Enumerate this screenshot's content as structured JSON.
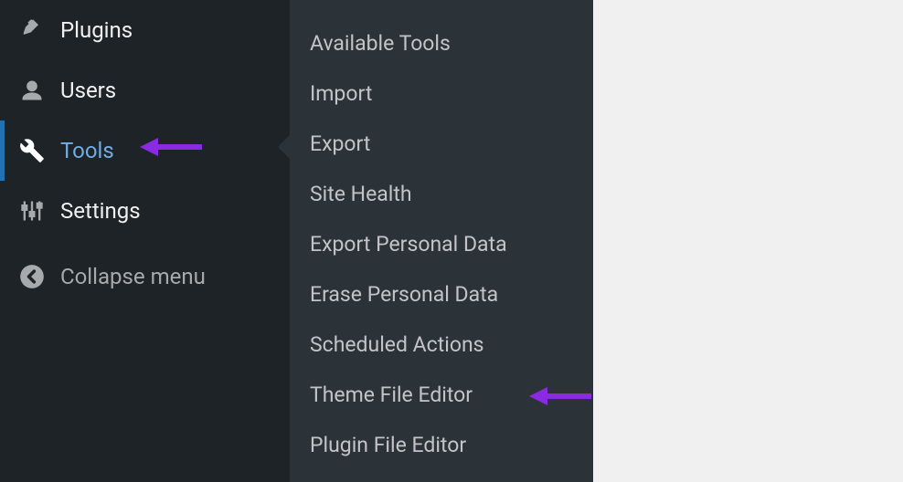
{
  "sidebar": {
    "items": [
      {
        "label": "Plugins",
        "icon": "plugin-icon"
      },
      {
        "label": "Users",
        "icon": "users-icon"
      },
      {
        "label": "Tools",
        "icon": "tools-icon",
        "active": true
      },
      {
        "label": "Settings",
        "icon": "settings-icon"
      }
    ],
    "collapse_label": "Collapse menu"
  },
  "submenu": {
    "items": [
      "Available Tools",
      "Import",
      "Export",
      "Site Health",
      "Export Personal Data",
      "Erase Personal Data",
      "Scheduled Actions",
      "Theme File Editor",
      "Plugin File Editor"
    ]
  },
  "annotations": {
    "arrow_color": "#8a2be2",
    "targets": [
      "Tools",
      "Theme File Editor"
    ]
  }
}
